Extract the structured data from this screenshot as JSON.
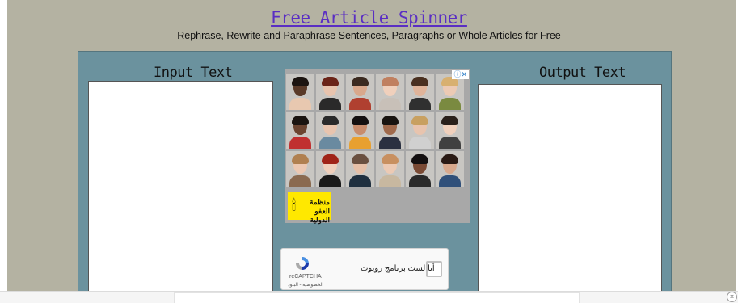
{
  "header": {
    "title": "Free Article Spinner",
    "subtitle": "Rephrase, Rewrite and Paraphrase Sentences, Paragraphs or Whole Articles for Free"
  },
  "tool": {
    "input_label": "Input Text",
    "output_label": "Output Text",
    "input_value": "",
    "output_value": ""
  },
  "ad": {
    "brand_text": "منظمة العفو الدولية",
    "faces": [
      {
        "skin": "#5a3a28",
        "hair": "#1c1410",
        "shirt": "#e8c8b0"
      },
      {
        "skin": "#e8c4ae",
        "hair": "#6b2418",
        "shirt": "#2a2a2a"
      },
      {
        "skin": "#d9a88c",
        "hair": "#3b2a20",
        "shirt": "#b04030"
      },
      {
        "skin": "#f0d0bc",
        "hair": "#c08060",
        "shirt": "#c8c0b8"
      },
      {
        "skin": "#e0b49a",
        "hair": "#4a3020",
        "shirt": "#303030"
      },
      {
        "skin": "#eccab4",
        "hair": "#d8b070",
        "shirt": "#7a8a40"
      },
      {
        "skin": "#6b4430",
        "hair": "#1a1410",
        "shirt": "#c03030"
      },
      {
        "skin": "#e8c4ae",
        "hair": "#2a2a2a",
        "shirt": "#6a8aa0"
      },
      {
        "skin": "#c88c6c",
        "hair": "#141010",
        "shirt": "#e8a030"
      },
      {
        "skin": "#a06a4c",
        "hair": "#181410",
        "shirt": "#2a3040"
      },
      {
        "skin": "#e8c4ae",
        "hair": "#c8a060",
        "shirt": "#d0d0d0"
      },
      {
        "skin": "#f0d0bc",
        "hair": "#2a201a",
        "shirt": "#404040"
      },
      {
        "skin": "#ecc8b2",
        "hair": "#b08050",
        "shirt": "#8a6a50"
      },
      {
        "skin": "#f0d0bc",
        "hair": "#a02418",
        "shirt": "#1a1a1a"
      },
      {
        "skin": "#e6c0a8",
        "hair": "#6a5040",
        "shirt": "#203040"
      },
      {
        "skin": "#eccab4",
        "hair": "#c89060",
        "shirt": "#c8b8a0"
      },
      {
        "skin": "#7a4a34",
        "hair": "#141010",
        "shirt": "#2a2a2a"
      },
      {
        "skin": "#d8a88c",
        "hair": "#2a1a14",
        "shirt": "#30507a"
      }
    ]
  },
  "captcha": {
    "label": "أنا لست برنامج روبوت",
    "brand": "reCAPTCHA",
    "terms": "الخصوصية - البنود"
  },
  "colors": {
    "panel": "#6b929e",
    "page": "#b4b2a2",
    "title_link": "#5a2ec3",
    "ad_brand": "#ffe800"
  },
  "bottom_ad": {
    "close_icon": "close-icon"
  }
}
